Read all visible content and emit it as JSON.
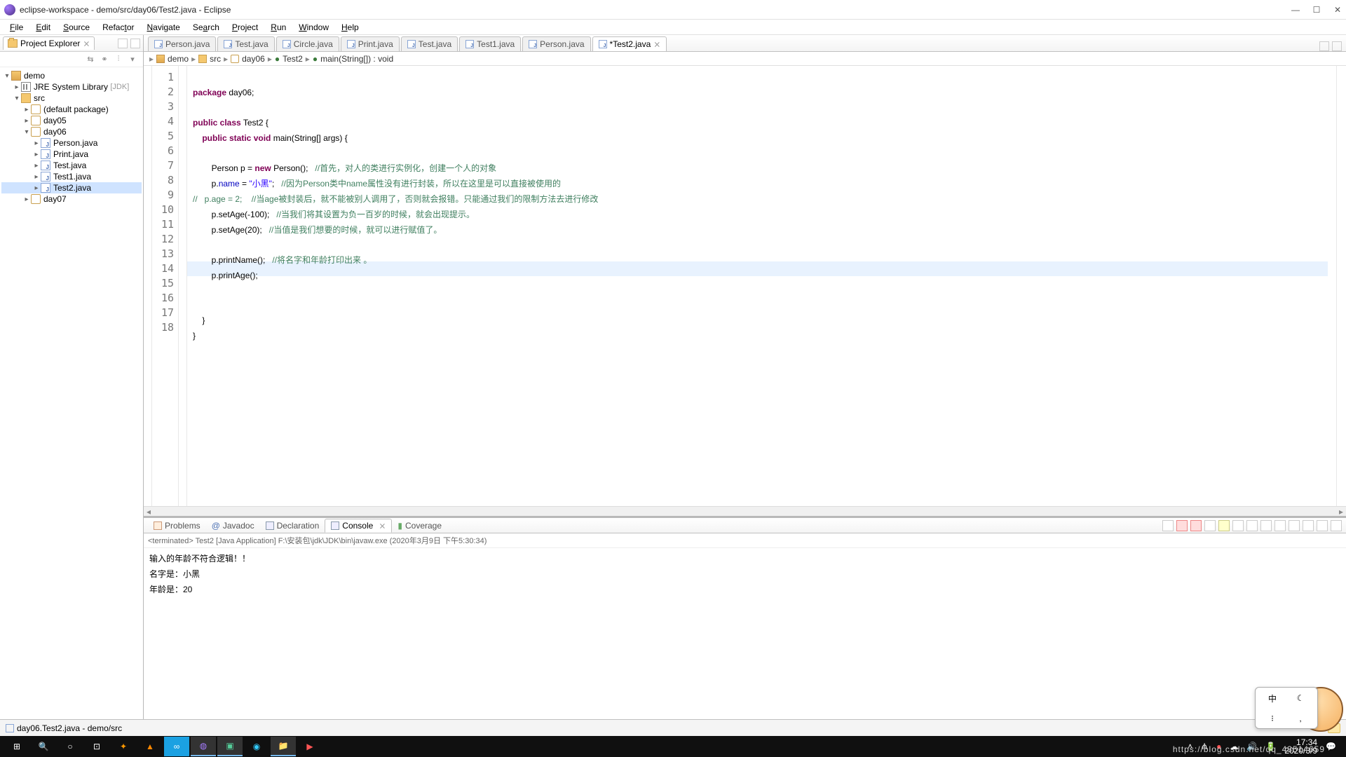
{
  "window": {
    "title": "eclipse-workspace - demo/src/day06/Test2.java - Eclipse"
  },
  "menu": [
    "File",
    "Edit",
    "Source",
    "Refactor",
    "Navigate",
    "Search",
    "Project",
    "Run",
    "Window",
    "Help"
  ],
  "explorer": {
    "title": "Project Explorer",
    "tree": {
      "project": "demo",
      "jre": "JRE System Library",
      "jre_suffix": "[JDK]",
      "src": "src",
      "pkg_default": "(default package)",
      "day05": "day05",
      "day06": "day06",
      "files": [
        "Person.java",
        "Print.java",
        "Test.java",
        "Test1.java",
        "Test2.java"
      ],
      "day07": "day07"
    }
  },
  "tabs": [
    "Person.java",
    "Test.java",
    "Circle.java",
    "Print.java",
    "Test.java",
    "Test1.java",
    "Person.java",
    "*Test2.java"
  ],
  "breadcrumb": [
    "demo",
    "src",
    "day06",
    "Test2",
    "main(String[]) : void"
  ],
  "code": {
    "lines": 18,
    "l1a": "package",
    "l1b": " day06;",
    "l3a": "public",
    "l3b": " class",
    "l3c": " Test2 {",
    "l4a": "    public",
    "l4b": " static",
    "l4c": " void",
    "l4d": " main(String[] args) {",
    "l6a": "        Person p = ",
    "l6b": "new",
    "l6c": " Person();   ",
    "l6d": "//首先，对人的类进行实例化，创建一个人的对象",
    "l7a": "        p.",
    "l7b": "name",
    "l7c": " = ",
    "l7d": "\"小黑\"",
    "l7e": ";   ",
    "l7f": "//因为Person类中name属性没有进行封装，所以在这里是可以直接被使用的",
    "l8a": "//   p.age = 2;    //当age被封装后，就不能被别人调用了，否则就会报错。只能通过我们的限制方法去进行修改",
    "l9a": "        p.setAge(-100);   ",
    "l9b": "//当我们将其设置为负一百岁的时候，就会出现提示。",
    "l10a": "        p.setAge(20);   ",
    "l10b": "//当值是我们想要的时候，就可以进行赋值了。",
    "l12a": "        p.printName();   ",
    "l12b": "//将名字和年龄打印出来 。",
    "l13": "        p.printAge();",
    "l16": "    }",
    "l17": "}"
  },
  "bottom": {
    "tabs": [
      "Problems",
      "Javadoc",
      "Declaration",
      "Console",
      "Coverage"
    ],
    "terminate": "<terminated> Test2 [Java Application] F:\\安装包\\jdk\\JDK\\bin\\javaw.exe (2020年3月9日 下午5:30:34)",
    "out1": "输入的年龄不符合逻辑！！",
    "out2": "名字是：小黑",
    "out3": "年龄是：20"
  },
  "status": {
    "path": "day06.Test2.java - demo/src"
  },
  "taskbar": {
    "time": "17:34",
    "date": "2020/3/9"
  },
  "ime": [
    "中",
    "☾",
    "⁝",
    ",",
    "⌨"
  ],
  "watermark": "https://blog.csdn.net/qq_43514659"
}
